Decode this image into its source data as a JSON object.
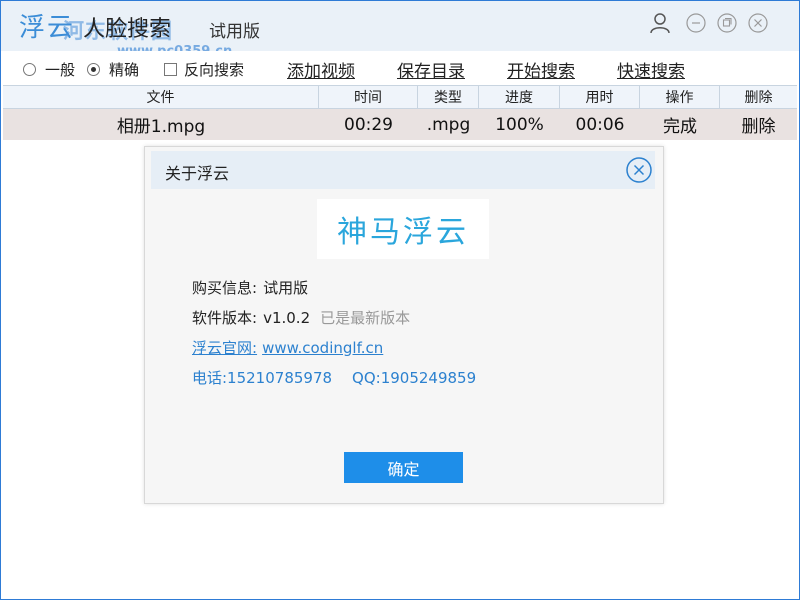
{
  "window": {
    "logo_text": "浮云",
    "title": "人脸搜索",
    "edition": "试用版",
    "watermark": "河东软件园",
    "watermark_url": "www.pc0359.cn",
    "accent_color": "#2e7bd6"
  },
  "toolbar": {
    "modes": [
      {
        "label": "一般",
        "checked": false
      },
      {
        "label": "精确",
        "checked": true
      }
    ],
    "reverse_search_label": "反向搜索",
    "reverse_search_checked": false,
    "add_video": "添加视频",
    "save_dir": "保存目录",
    "start_search": "开始搜索",
    "quick_search": "快速搜索"
  },
  "table": {
    "headers": {
      "file": "文件",
      "time": "时间",
      "type": "类型",
      "progress": "进度",
      "elapsed": "用时",
      "action": "操作",
      "delete": "删除"
    },
    "rows": [
      {
        "file": "相册1.mpg",
        "time": "00:29",
        "type": ".mpg",
        "progress": "100%",
        "elapsed": "00:06",
        "action": "完成",
        "delete": "删除"
      }
    ]
  },
  "about_dialog": {
    "title": "关于浮云",
    "brand": "神马浮云",
    "purchase_label": "购买信息:",
    "purchase_value": "试用版",
    "version_label": "软件版本:",
    "version_value": "v1.0.2",
    "version_status": "已是最新版本",
    "website_label": "浮云官网:",
    "website_value": "www.codinglf.cn",
    "phone": "电话:15210785978",
    "qq": "QQ:1905249859",
    "ok_button": "确定",
    "brand_color": "#2aa6dc",
    "button_color": "#1e8ee9"
  },
  "icons": {
    "user": "user-icon",
    "minimize": "minimize-icon",
    "maximize": "maximize-icon",
    "close": "close-icon",
    "dialog_close": "dialog-close-icon"
  }
}
